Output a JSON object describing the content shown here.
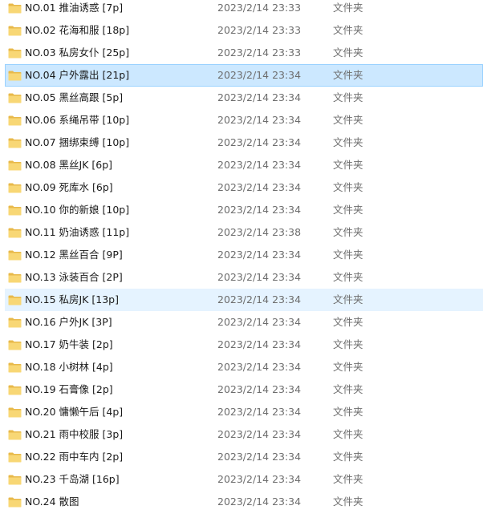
{
  "file_list": {
    "selected_index": 3,
    "hover_index": 13,
    "icon": "folder-icon",
    "colors": {
      "selected_bg": "#cce8ff",
      "selected_border": "#99d1ff",
      "hover_bg": "#e5f3ff",
      "folder_body": "#f8d775",
      "folder_tab": "#e8b94a"
    },
    "items": [
      {
        "name": "NO.01 推油诱惑 [7p]",
        "date": "2023/2/14 23:33",
        "type": "文件夹"
      },
      {
        "name": "NO.02 花海和服 [18p]",
        "date": "2023/2/14 23:33",
        "type": "文件夹"
      },
      {
        "name": "NO.03 私房女仆 [25p]",
        "date": "2023/2/14 23:33",
        "type": "文件夹"
      },
      {
        "name": "NO.04 户外露出 [21p]",
        "date": "2023/2/14 23:34",
        "type": "文件夹"
      },
      {
        "name": "NO.05 黑丝高跟 [5p]",
        "date": "2023/2/14 23:34",
        "type": "文件夹"
      },
      {
        "name": "NO.06 系绳吊带 [10p]",
        "date": "2023/2/14 23:34",
        "type": "文件夹"
      },
      {
        "name": "NO.07 捆绑束缚 [10p]",
        "date": "2023/2/14 23:34",
        "type": "文件夹"
      },
      {
        "name": "NO.08 黑丝JK [6p]",
        "date": "2023/2/14 23:34",
        "type": "文件夹"
      },
      {
        "name": "NO.09 死库水 [6p]",
        "date": "2023/2/14 23:34",
        "type": "文件夹"
      },
      {
        "name": "NO.10 你的新娘 [10p]",
        "date": "2023/2/14 23:34",
        "type": "文件夹"
      },
      {
        "name": "NO.11 奶油诱惑 [11p]",
        "date": "2023/2/14 23:38",
        "type": "文件夹"
      },
      {
        "name": "NO.12 黑丝百合 [9P]",
        "date": "2023/2/14 23:34",
        "type": "文件夹"
      },
      {
        "name": "NO.13 泳装百合 [2P]",
        "date": "2023/2/14 23:34",
        "type": "文件夹"
      },
      {
        "name": "NO.15 私房JK [13p]",
        "date": "2023/2/14 23:34",
        "type": "文件夹"
      },
      {
        "name": "NO.16 户外JK [3P]",
        "date": "2023/2/14 23:34",
        "type": "文件夹"
      },
      {
        "name": "NO.17 奶牛装 [2p]",
        "date": "2023/2/14 23:34",
        "type": "文件夹"
      },
      {
        "name": "NO.18 小树林 [4p]",
        "date": "2023/2/14 23:34",
        "type": "文件夹"
      },
      {
        "name": "NO.19 石膏像 [2p]",
        "date": "2023/2/14 23:34",
        "type": "文件夹"
      },
      {
        "name": "NO.20 慵懒午后 [4p]",
        "date": "2023/2/14 23:34",
        "type": "文件夹"
      },
      {
        "name": "NO.21 雨中校服 [3p]",
        "date": "2023/2/14 23:34",
        "type": "文件夹"
      },
      {
        "name": "NO.22 雨中车内 [2p]",
        "date": "2023/2/14 23:34",
        "type": "文件夹"
      },
      {
        "name": "NO.23 千岛湖 [16p]",
        "date": "2023/2/14 23:34",
        "type": "文件夹"
      },
      {
        "name": "NO.24 散图",
        "date": "2023/2/14 23:34",
        "type": "文件夹"
      }
    ]
  }
}
